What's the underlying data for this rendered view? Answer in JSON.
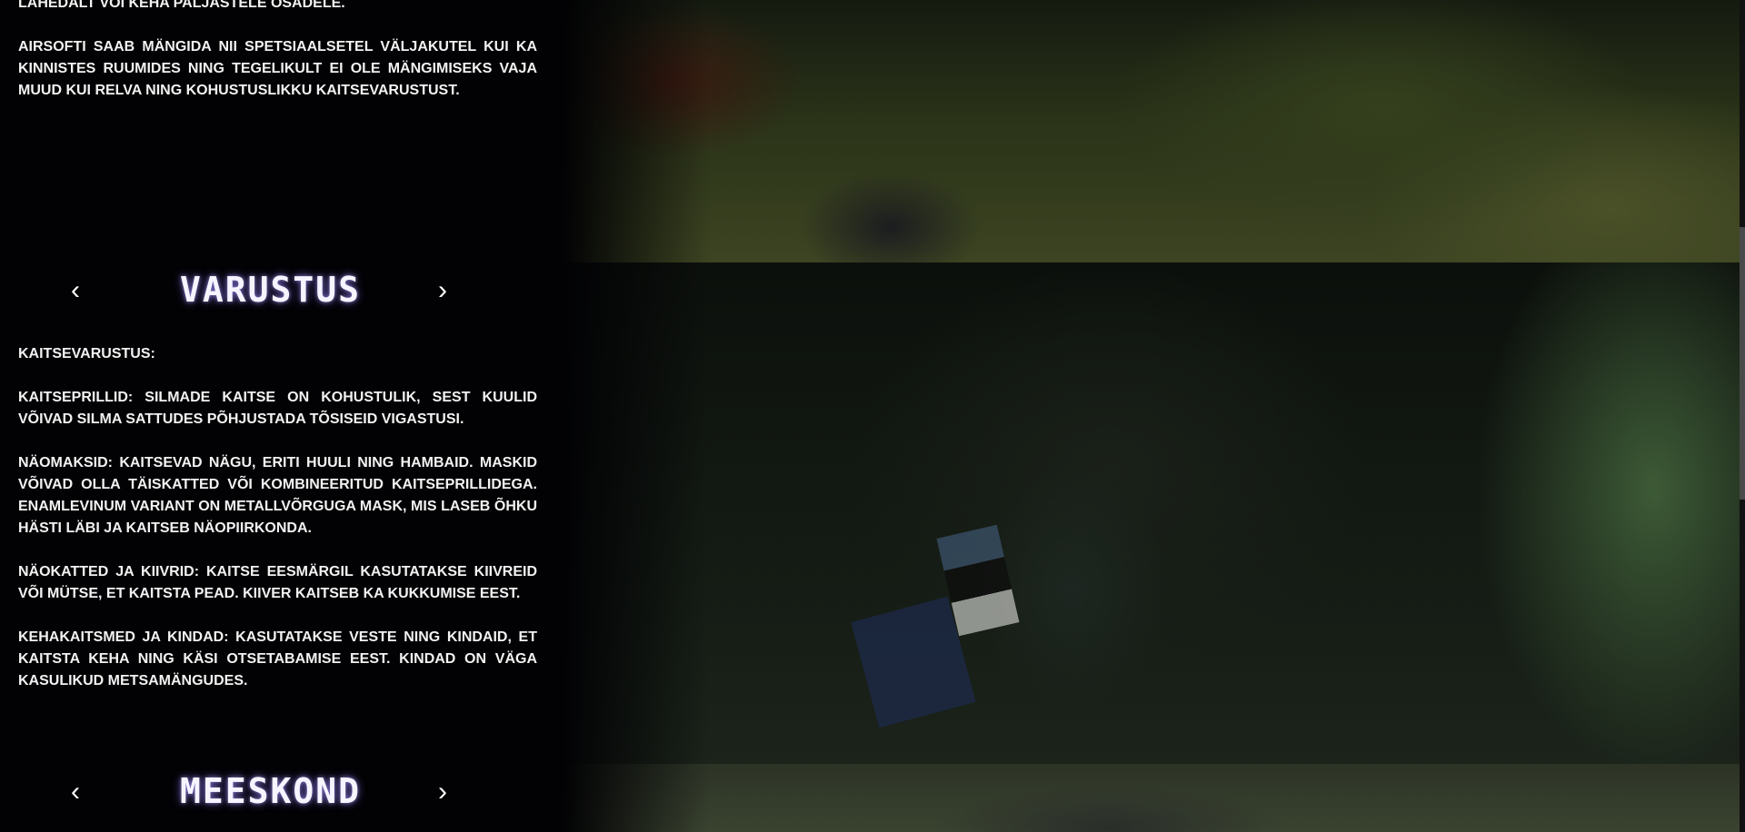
{
  "intro": {
    "paragraphs": [
      "Lähedalt või keha paljastele osadele.",
      "Airsofti saab mängida nii spetsiaalsetel väljakutel kui ka kinnistes ruumides ning tegelikult ei ole mängimiseks vaja muud kui relva ning kohustuslikku kaitsevarustust."
    ]
  },
  "varustus": {
    "title": "VARUSTUS",
    "prev": "‹",
    "next": "›",
    "paragraphs": [
      "Kaitsevarustus:",
      "Kaitseprillid: Silmade kaitse on kohustulik, sest kuulid võivad silma sattudes põhjustada tõsiseid vigastusi.",
      "Näomaksid: Kaitsevad nägu, eriti huuli ning hambaid. Maskid võivad olla täiskatted või kombineeritud kaitseprillidega. Enamlevinum variant on metallvõrguga mask, mis laseb õhku hästi läbi ja kaitseb näopiirkonda.",
      "Näokatted ja kiivrid: Kaitse eesmärgil kasutatakse kiivreid või mütse, et kaitsta pead. Kiiver kaitseb ka kukkumise eest.",
      "Kehakaitsmed ja kindad: Kasutatakse veste ning kindaid, et kaitsta keha ning käsi otsetabamise eest. Kindad on väga kasulikud metsamängudes."
    ]
  },
  "meeskond": {
    "title": "MEESKOND",
    "prev": "‹",
    "next": "›"
  }
}
